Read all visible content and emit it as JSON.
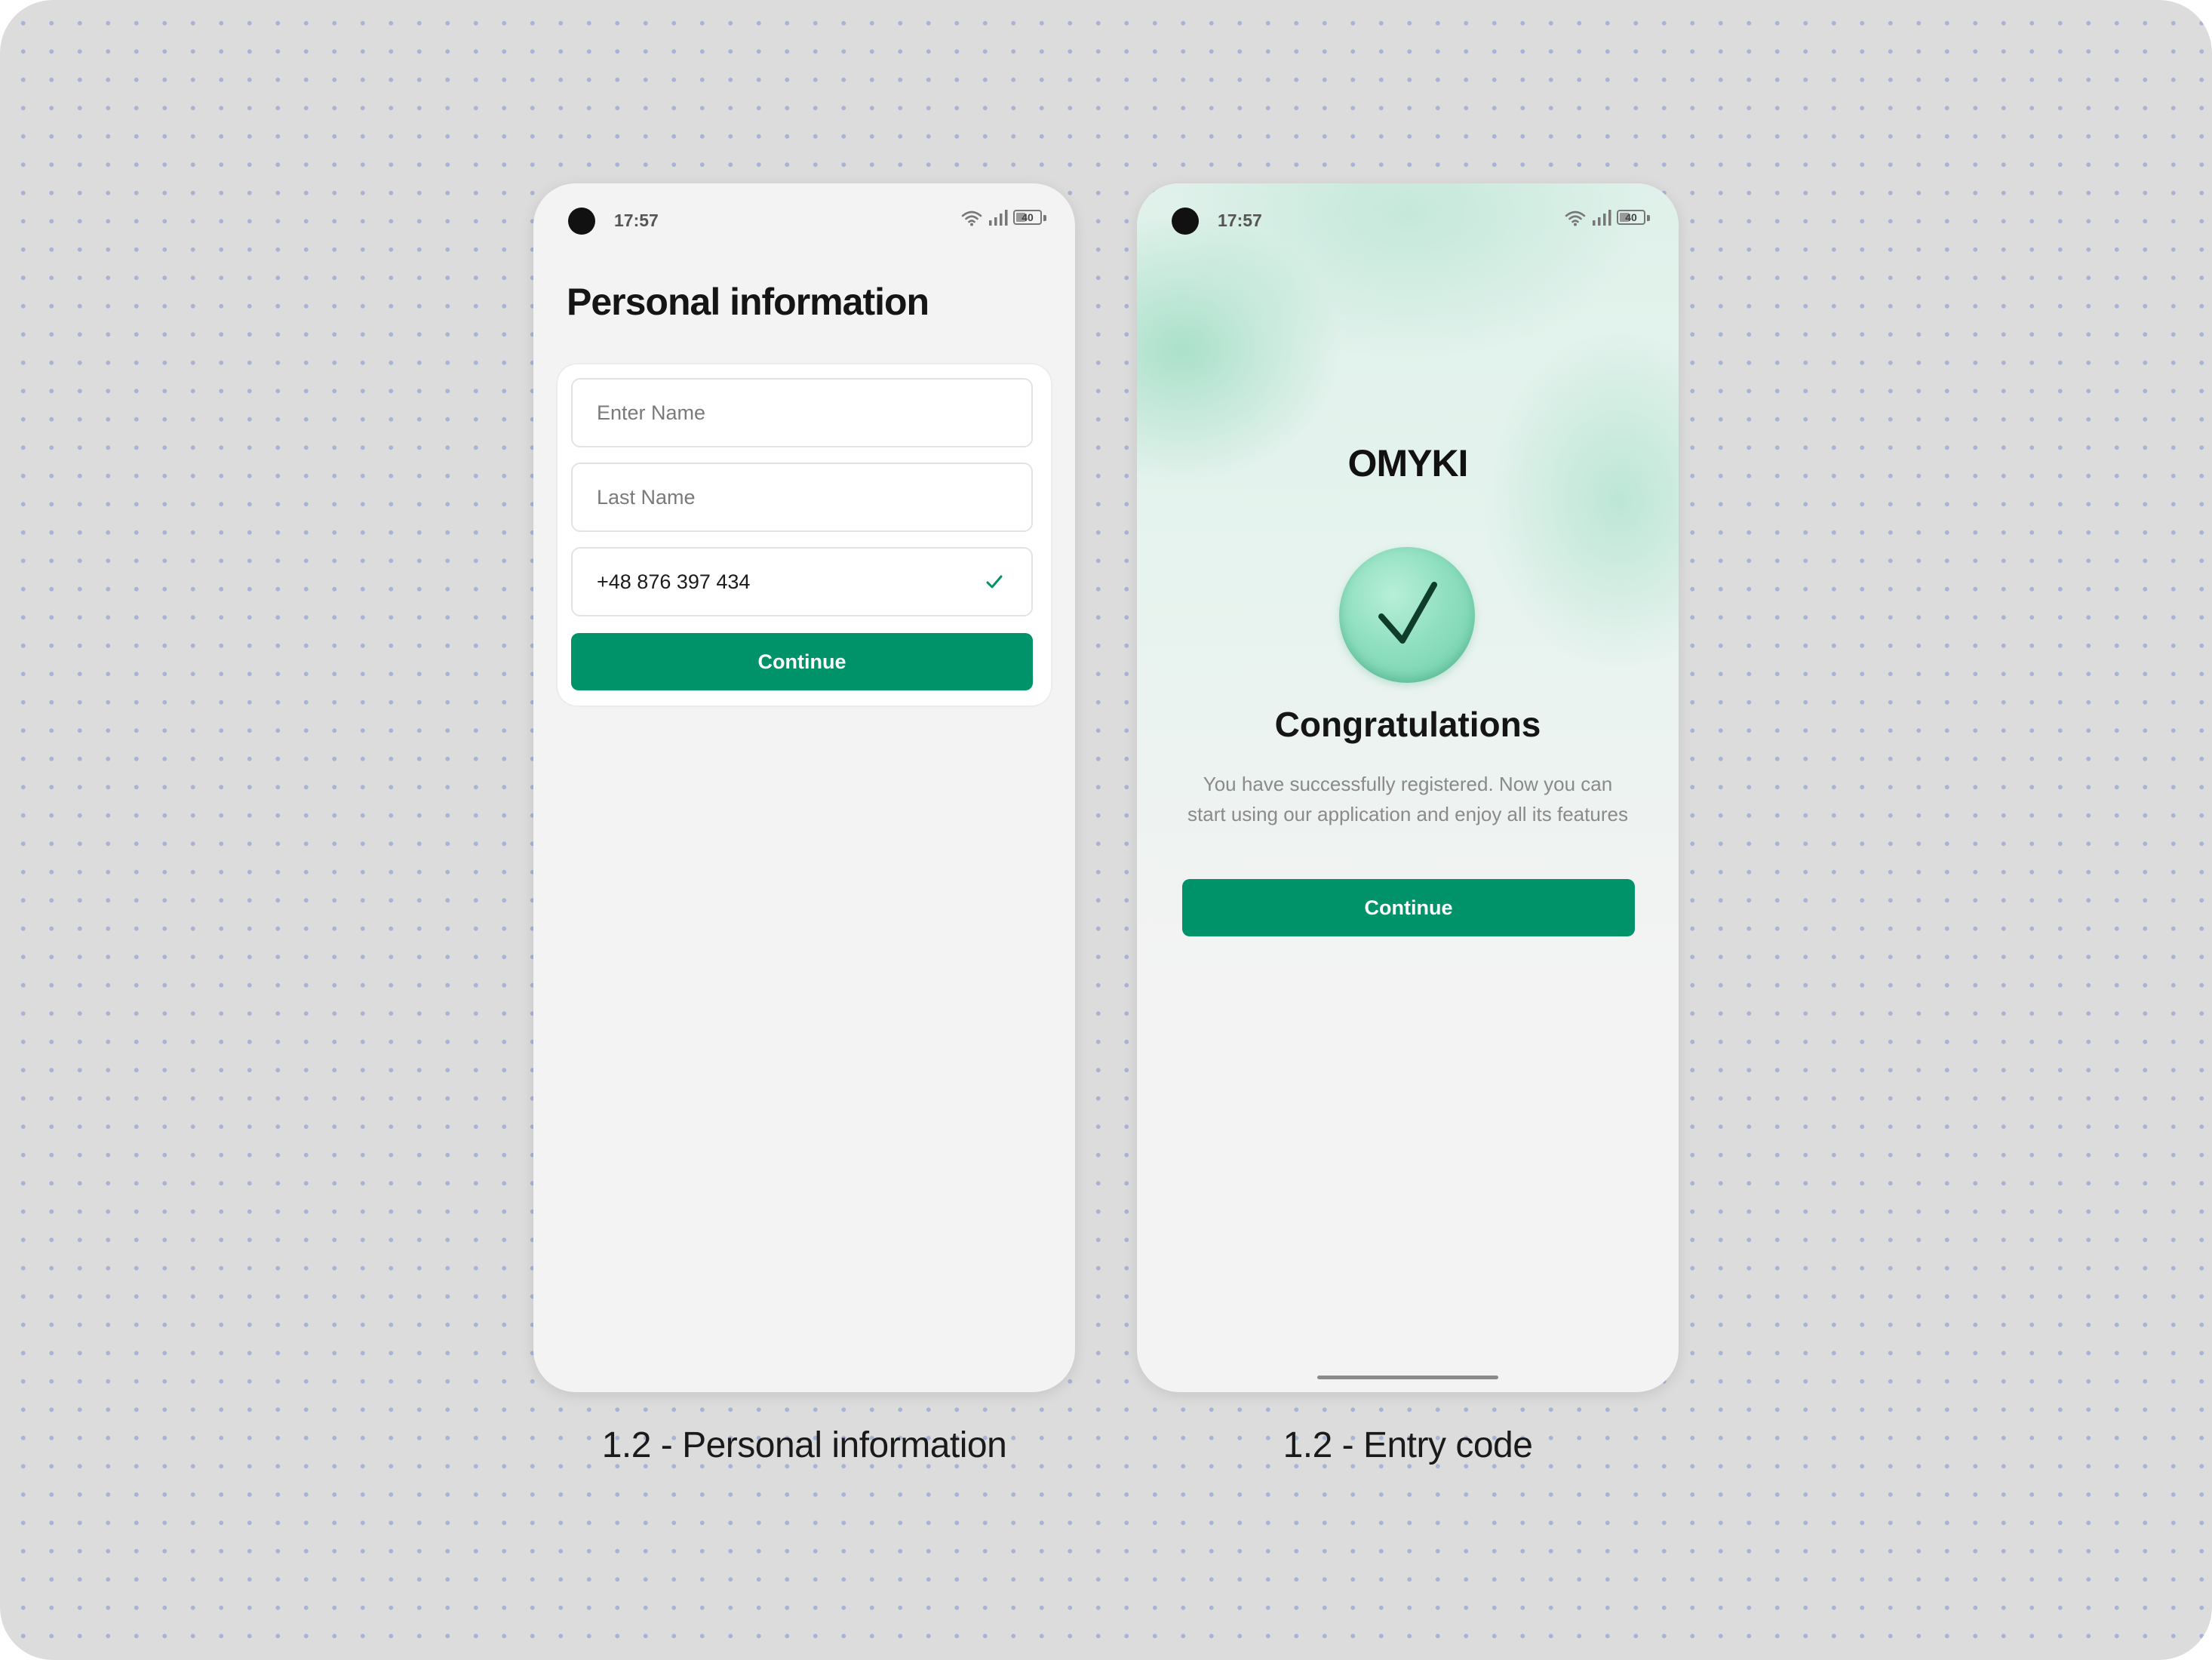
{
  "colors": {
    "accent": "#00936a",
    "background": "#dcdcdc",
    "phone_background": "#f3f3f3",
    "mint": "#8fdfc0"
  },
  "status_bar": {
    "time": "17:57",
    "battery_level": "40",
    "icons": [
      "wifi-icon",
      "signal-icon",
      "battery-icon"
    ]
  },
  "screen1": {
    "title": "Personal information",
    "fields": {
      "first_name": {
        "placeholder": "Enter Name",
        "value": ""
      },
      "last_name": {
        "placeholder": "Last Name",
        "value": ""
      },
      "phone": {
        "value": "+48 876 397 434",
        "verified_icon": "check-icon"
      }
    },
    "continue_label": "Continue",
    "caption": "1.2 - Personal information"
  },
  "screen2": {
    "logo": "OMYKI",
    "success_icon": "check-icon",
    "heading": "Congratulations",
    "description": "You have successfully registered. Now you can start using our application and enjoy all its features",
    "continue_label": "Continue",
    "caption": "1.2 - Entry code"
  }
}
